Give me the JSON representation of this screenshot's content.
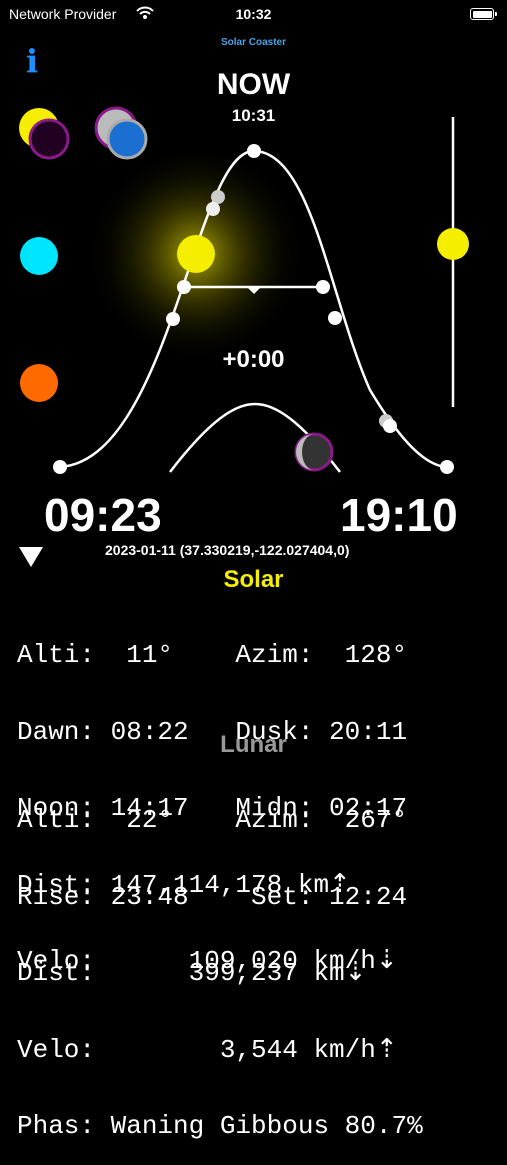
{
  "status_bar": {
    "carrier": "Network Provider",
    "time": "10:32"
  },
  "app_title": "Solar Coaster",
  "info_label": "i",
  "now": {
    "label": "NOW",
    "time": "10:31"
  },
  "offset": "+0:00",
  "sunrise": "09:23",
  "sunset": "19:10",
  "meta": "2023-01-11 (37.330219,-122.027404,0)",
  "solar": {
    "heading": "Solar",
    "lines": [
      "Alti:  11°    Azim:  128°",
      "Dawn: 08:22   Dusk: 20:11",
      "Noon: 14:17   Midn: 02:17",
      "Dist: 147,114,178 km⇡",
      "Velo:      109,020 km/h⇣"
    ]
  },
  "lunar": {
    "heading": "Lunar",
    "lines": [
      "Alti:  22°    Azim:  267°",
      "Rise: 23:48    Set: 12:24",
      "Dist:      399,237 km⇣",
      "Velo:        3,544 km/h⇡",
      "Phas: Waning Gibbous 80.7%"
    ]
  },
  "colors": {
    "sun": "#f5ee00",
    "accent": "#1e8fff",
    "lunar_heading": "#999999",
    "cyan": "#00e5ff",
    "orange": "#ff6a00"
  },
  "icons": [
    "wifi-icon",
    "battery-icon",
    "info-icon",
    "sun-moon-toggle-icon",
    "moon-toggle-icon",
    "cyan-dot-icon",
    "orange-dot-icon",
    "disclosure-triangle-icon"
  ]
}
